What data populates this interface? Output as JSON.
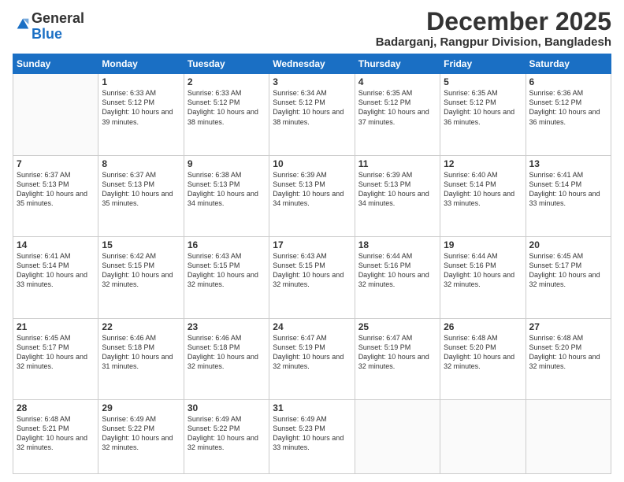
{
  "logo": {
    "general": "General",
    "blue": "Blue"
  },
  "header": {
    "title": "December 2025",
    "subtitle": "Badarganj, Rangpur Division, Bangladesh"
  },
  "weekdays": [
    "Sunday",
    "Monday",
    "Tuesday",
    "Wednesday",
    "Thursday",
    "Friday",
    "Saturday"
  ],
  "weeks": [
    [
      {
        "day": "",
        "info": ""
      },
      {
        "day": "1",
        "info": "Sunrise: 6:33 AM\nSunset: 5:12 PM\nDaylight: 10 hours and 39 minutes."
      },
      {
        "day": "2",
        "info": "Sunrise: 6:33 AM\nSunset: 5:12 PM\nDaylight: 10 hours and 38 minutes."
      },
      {
        "day": "3",
        "info": "Sunrise: 6:34 AM\nSunset: 5:12 PM\nDaylight: 10 hours and 38 minutes."
      },
      {
        "day": "4",
        "info": "Sunrise: 6:35 AM\nSunset: 5:12 PM\nDaylight: 10 hours and 37 minutes."
      },
      {
        "day": "5",
        "info": "Sunrise: 6:35 AM\nSunset: 5:12 PM\nDaylight: 10 hours and 36 minutes."
      },
      {
        "day": "6",
        "info": "Sunrise: 6:36 AM\nSunset: 5:12 PM\nDaylight: 10 hours and 36 minutes."
      }
    ],
    [
      {
        "day": "7",
        "info": "Sunrise: 6:37 AM\nSunset: 5:13 PM\nDaylight: 10 hours and 35 minutes."
      },
      {
        "day": "8",
        "info": "Sunrise: 6:37 AM\nSunset: 5:13 PM\nDaylight: 10 hours and 35 minutes."
      },
      {
        "day": "9",
        "info": "Sunrise: 6:38 AM\nSunset: 5:13 PM\nDaylight: 10 hours and 34 minutes."
      },
      {
        "day": "10",
        "info": "Sunrise: 6:39 AM\nSunset: 5:13 PM\nDaylight: 10 hours and 34 minutes."
      },
      {
        "day": "11",
        "info": "Sunrise: 6:39 AM\nSunset: 5:13 PM\nDaylight: 10 hours and 34 minutes."
      },
      {
        "day": "12",
        "info": "Sunrise: 6:40 AM\nSunset: 5:14 PM\nDaylight: 10 hours and 33 minutes."
      },
      {
        "day": "13",
        "info": "Sunrise: 6:41 AM\nSunset: 5:14 PM\nDaylight: 10 hours and 33 minutes."
      }
    ],
    [
      {
        "day": "14",
        "info": "Sunrise: 6:41 AM\nSunset: 5:14 PM\nDaylight: 10 hours and 33 minutes."
      },
      {
        "day": "15",
        "info": "Sunrise: 6:42 AM\nSunset: 5:15 PM\nDaylight: 10 hours and 32 minutes."
      },
      {
        "day": "16",
        "info": "Sunrise: 6:43 AM\nSunset: 5:15 PM\nDaylight: 10 hours and 32 minutes."
      },
      {
        "day": "17",
        "info": "Sunrise: 6:43 AM\nSunset: 5:15 PM\nDaylight: 10 hours and 32 minutes."
      },
      {
        "day": "18",
        "info": "Sunrise: 6:44 AM\nSunset: 5:16 PM\nDaylight: 10 hours and 32 minutes."
      },
      {
        "day": "19",
        "info": "Sunrise: 6:44 AM\nSunset: 5:16 PM\nDaylight: 10 hours and 32 minutes."
      },
      {
        "day": "20",
        "info": "Sunrise: 6:45 AM\nSunset: 5:17 PM\nDaylight: 10 hours and 32 minutes."
      }
    ],
    [
      {
        "day": "21",
        "info": "Sunrise: 6:45 AM\nSunset: 5:17 PM\nDaylight: 10 hours and 32 minutes."
      },
      {
        "day": "22",
        "info": "Sunrise: 6:46 AM\nSunset: 5:18 PM\nDaylight: 10 hours and 31 minutes."
      },
      {
        "day": "23",
        "info": "Sunrise: 6:46 AM\nSunset: 5:18 PM\nDaylight: 10 hours and 32 minutes."
      },
      {
        "day": "24",
        "info": "Sunrise: 6:47 AM\nSunset: 5:19 PM\nDaylight: 10 hours and 32 minutes."
      },
      {
        "day": "25",
        "info": "Sunrise: 6:47 AM\nSunset: 5:19 PM\nDaylight: 10 hours and 32 minutes."
      },
      {
        "day": "26",
        "info": "Sunrise: 6:48 AM\nSunset: 5:20 PM\nDaylight: 10 hours and 32 minutes."
      },
      {
        "day": "27",
        "info": "Sunrise: 6:48 AM\nSunset: 5:20 PM\nDaylight: 10 hours and 32 minutes."
      }
    ],
    [
      {
        "day": "28",
        "info": "Sunrise: 6:48 AM\nSunset: 5:21 PM\nDaylight: 10 hours and 32 minutes."
      },
      {
        "day": "29",
        "info": "Sunrise: 6:49 AM\nSunset: 5:22 PM\nDaylight: 10 hours and 32 minutes."
      },
      {
        "day": "30",
        "info": "Sunrise: 6:49 AM\nSunset: 5:22 PM\nDaylight: 10 hours and 32 minutes."
      },
      {
        "day": "31",
        "info": "Sunrise: 6:49 AM\nSunset: 5:23 PM\nDaylight: 10 hours and 33 minutes."
      },
      {
        "day": "",
        "info": ""
      },
      {
        "day": "",
        "info": ""
      },
      {
        "day": "",
        "info": ""
      }
    ]
  ]
}
